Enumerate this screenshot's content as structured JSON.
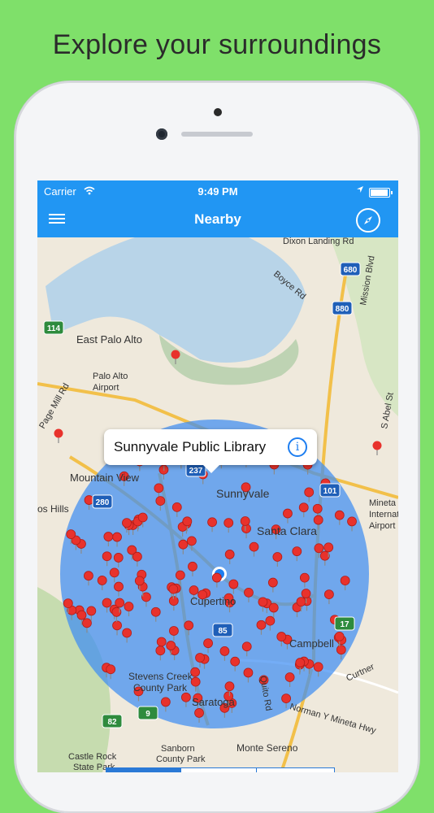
{
  "headline": "Explore your surroundings",
  "status_bar": {
    "carrier": "Carrier",
    "time": "9:49 PM",
    "icons": [
      "wifi-icon",
      "location-arrow-icon",
      "battery-icon"
    ]
  },
  "nav": {
    "title": "Nearby",
    "left_icon": "menu-icon",
    "right_icon": "compass-icon"
  },
  "callout": {
    "title": "Sunnyvale Public Library",
    "icon": "info-icon"
  },
  "map": {
    "places": [
      "East Palo Alto",
      "Palo Alto Airport",
      "Mountain View",
      "Sunnyvale",
      "Santa Clara",
      "Cupertino",
      "Campbell",
      "Saratoga",
      "Stevens Creek County Park",
      "Monte Sereno",
      "Castle Rock State Park",
      "Sanborn County Park",
      "Mineta International Airport",
      "Los Altos Hills"
    ],
    "roads": [
      "Dixon Landing Rd",
      "Boyce Rd",
      "Mission Blvd",
      "Page Mill Rd",
      "S Abel St",
      "Curtner Ave",
      "Norman Y Mineta Hwy",
      "Quito Rd"
    ],
    "highway_shields": [
      "680",
      "880",
      "114",
      "280",
      "101",
      "237",
      "85",
      "17",
      "82",
      "9"
    ],
    "colors": {
      "water": "#b8d4e8",
      "land": "#efe9dc",
      "radius": "#3f8ef2",
      "pin": "#e8322c"
    }
  }
}
